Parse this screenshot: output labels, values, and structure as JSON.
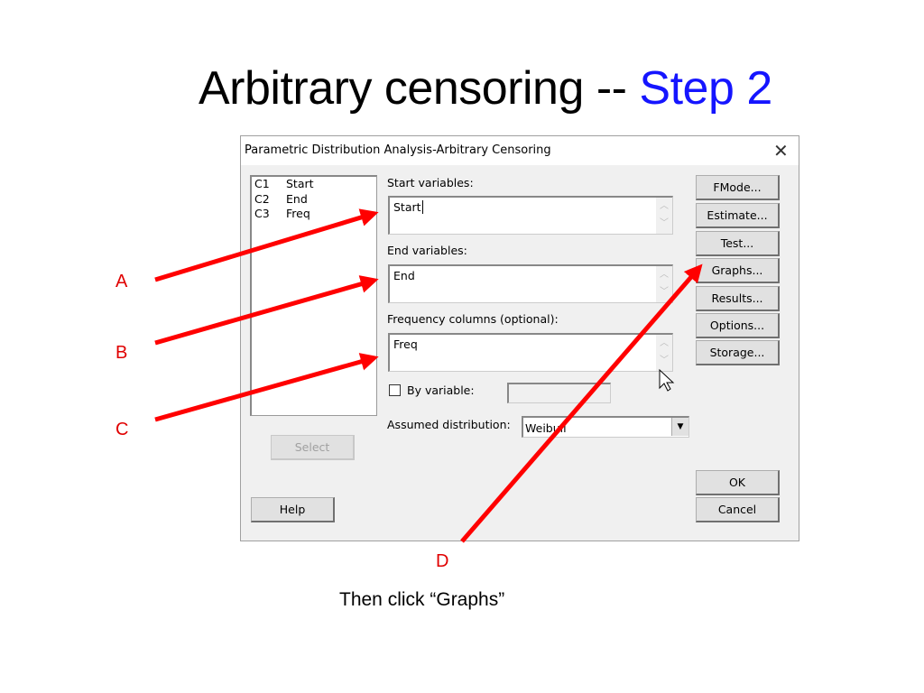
{
  "slide": {
    "title_main": "Arbitrary censoring -- ",
    "title_highlight": "Step 2",
    "highlight_color": "#1515ff",
    "annotation_color": "#ff0000",
    "markers": [
      "A",
      "B",
      "C",
      "D"
    ],
    "caption": "Then click “Graphs”"
  },
  "dialog": {
    "title": "Parametric Distribution Analysis-Arbitrary Censoring",
    "close_icon": "close-icon",
    "columns": [
      {
        "id": "C1",
        "name": "Start"
      },
      {
        "id": "C2",
        "name": "End"
      },
      {
        "id": "C3",
        "name": "Freq"
      }
    ],
    "start_label": "Start variables:",
    "start_value": "Start",
    "end_label": "End variables:",
    "end_value": "End",
    "freq_label": "Frequency columns (optional):",
    "freq_value": "Freq",
    "by_variable_label": "By variable:",
    "by_variable_checked": false,
    "distribution_label": "Assumed distribution:",
    "distribution_value": "Weibull",
    "select_button": "Select",
    "help_button": "Help",
    "side_buttons": [
      "FMode...",
      "Estimate...",
      "Test...",
      "Graphs...",
      "Results...",
      "Options...",
      "Storage..."
    ],
    "ok_button": "OK",
    "cancel_button": "Cancel"
  }
}
